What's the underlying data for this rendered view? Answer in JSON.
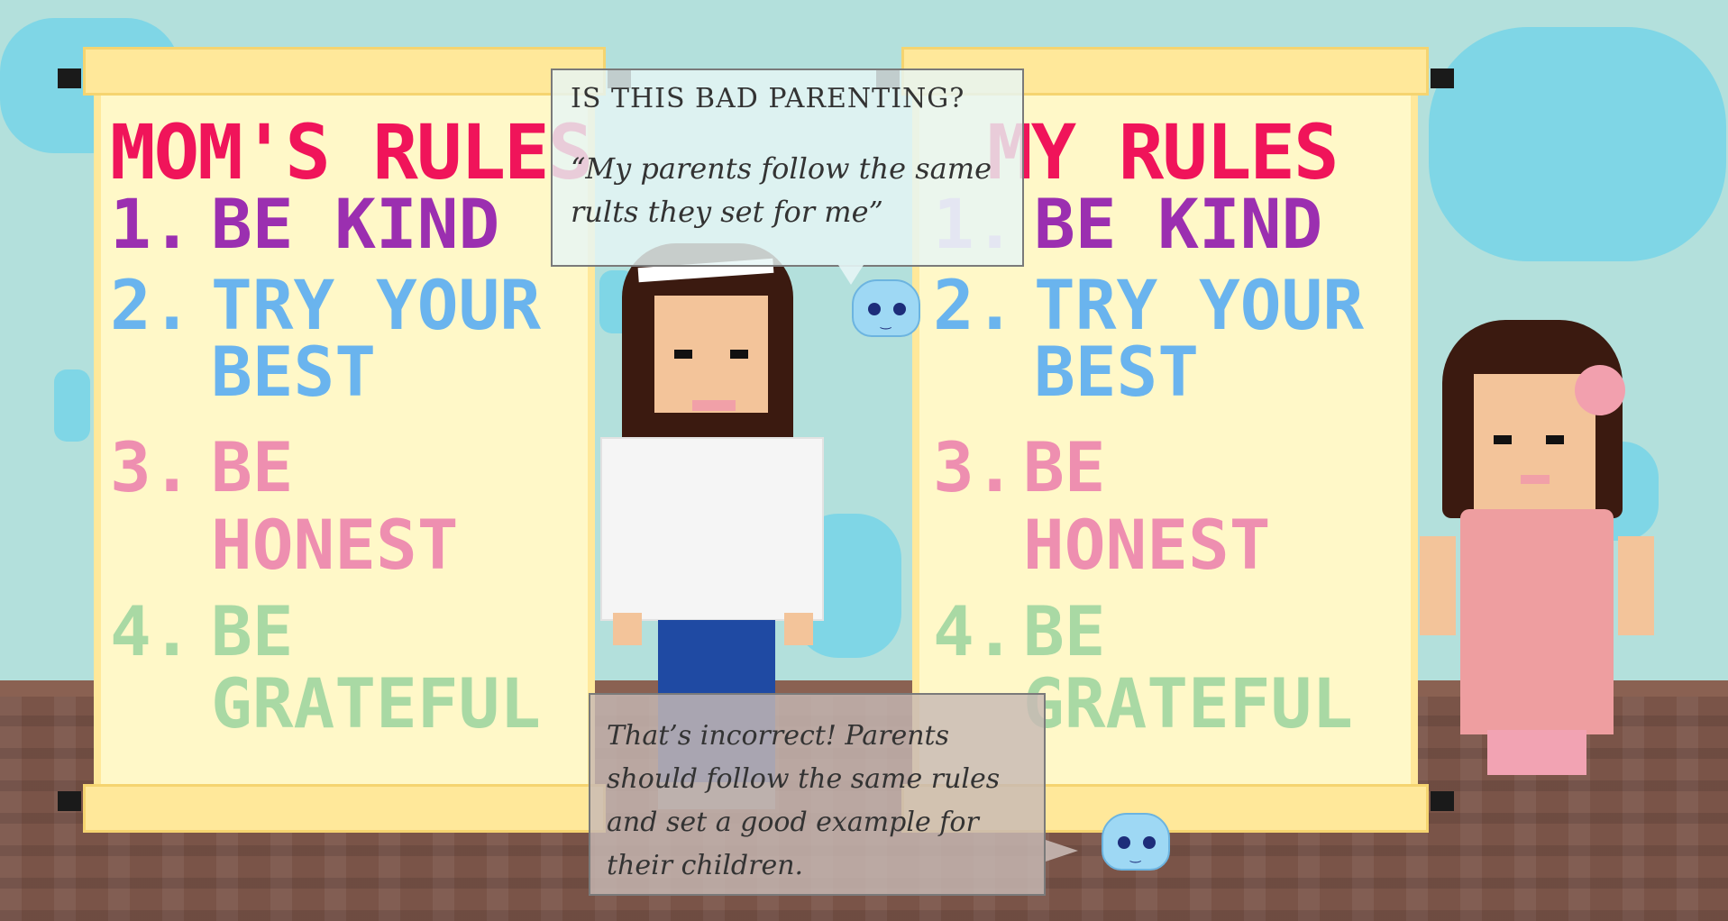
{
  "left_scroll": {
    "title": "MOM'S RULES",
    "rules": [
      {
        "num": "1.",
        "line1": "BE KIND",
        "line2": ""
      },
      {
        "num": "2.",
        "line1": "TRY YOUR",
        "line2": "BEST"
      },
      {
        "num": "3.",
        "line1": "BE",
        "line2": "HONEST"
      },
      {
        "num": "4.",
        "line1": "BE",
        "line2": "GRATEFUL"
      }
    ]
  },
  "right_scroll": {
    "title": "MY RULES",
    "rules": [
      {
        "num": "1.",
        "line1": "BE KIND",
        "line2": ""
      },
      {
        "num": "2.",
        "line1": "TRY YOUR",
        "line2": "BEST"
      },
      {
        "num": "3.",
        "line1": "BE",
        "line2": "HONEST"
      },
      {
        "num": "4.",
        "line1": "BE",
        "line2": "GRATEFUL"
      }
    ]
  },
  "question_bubble": {
    "title": "IS THIS BAD PARENTING?",
    "body": "“My parents follow the same rults they set for me”"
  },
  "answer_bubble": {
    "body": "That’s incorrect! Parents should follow the same rules and set a good example for their children."
  },
  "colors": {
    "title_red": "#f0145a",
    "rule1_purple": "#9b2fb0",
    "rule2_blue": "#6ab4ee",
    "rule3_pink": "#ee8fb0",
    "rule4_green": "#a9d9a4",
    "wall": "#b3e0dc",
    "floor": "#7a5448"
  }
}
